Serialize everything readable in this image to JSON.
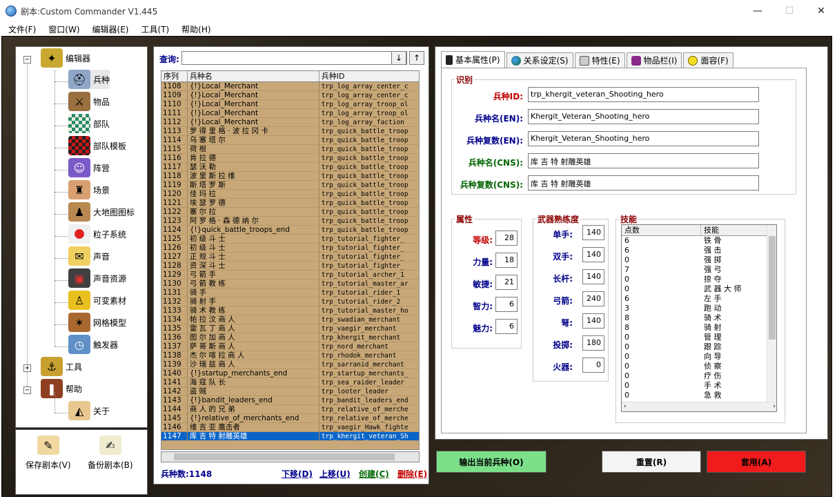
{
  "window": {
    "title": "剧本:Custom Commander V1.445",
    "minimize": "—",
    "maximize": "☐",
    "close": "✕"
  },
  "menu": [
    "文件(F)",
    "窗口(W)",
    "编辑器(E)",
    "工具(T)",
    "帮助(H)"
  ],
  "tree": {
    "editor": "编辑器",
    "items": [
      "兵种",
      "物品",
      "部队",
      "部队模板",
      "阵营",
      "场景",
      "大地图图标",
      "粒子系统",
      "声音",
      "声音资源",
      "可变素材",
      "网格模型",
      "触发器"
    ],
    "tools": "工具",
    "help": "帮助",
    "about": "关于",
    "minus": "−",
    "plus": "+"
  },
  "bottom_left": {
    "save": "保存剧本(V)",
    "backup": "备份剧本(B)"
  },
  "query": {
    "label": "查询:",
    "down": "↓",
    "up": "↑"
  },
  "grid": {
    "headers": [
      "序列",
      "兵种名",
      "兵种ID"
    ],
    "rows": [
      [
        "1108",
        "{!}Local_Merchant",
        "trp_log_array_center_c"
      ],
      [
        "1109",
        "{!}Local_Merchant",
        "trp_log_array_center_c"
      ],
      [
        "1110",
        "{!}Local_Merchant",
        "trp_log_array_troop_ol"
      ],
      [
        "1111",
        "{!}Local_Merchant",
        "trp_log_array_troop_ol"
      ],
      [
        "1112",
        "{!}Local_Merchant",
        "trp_log_array_faction"
      ],
      [
        "1113",
        "罗 得 里 格 · 波 拉 冈 卡",
        "trp_quick_battle_troop"
      ],
      [
        "1114",
        "乌 塞 塔 尔",
        "trp_quick_battle_troop"
      ],
      [
        "1115",
        "荷 根",
        "trp_quick_battle_troop"
      ],
      [
        "1116",
        "肯 拉 德",
        "trp_quick_battle_troop"
      ],
      [
        "1117",
        "瑟 沃 勒",
        "trp_quick_battle_troop"
      ],
      [
        "1118",
        "波 里 斯 拉 维",
        "trp_quick_battle_troop"
      ],
      [
        "1119",
        "斯 塔 罗 斯",
        "trp_quick_battle_troop"
      ],
      [
        "1120",
        "佳 玛 拉",
        "trp_quick_battle_troop"
      ],
      [
        "1121",
        "埃 瑟 罗 德",
        "trp_quick_battle_troop"
      ],
      [
        "1122",
        "塞 尔 拉",
        "trp_quick_battle_troop"
      ],
      [
        "1123",
        "阿 罗 格 · 森 德 纳 尔",
        "trp_quick_battle_troop"
      ],
      [
        "1124",
        "{!}quick_battle_troops_end",
        "trp_quick_battle_troop"
      ],
      [
        "1125",
        "初 级 斗 士",
        "trp_tutorial_fighter_"
      ],
      [
        "1126",
        "初 级 斗 士",
        "trp_tutorial_fighter_"
      ],
      [
        "1127",
        "正 规 斗 士",
        "trp_tutorial_fighter_"
      ],
      [
        "1128",
        "资 深 斗 士",
        "trp_tutorial_fighter_"
      ],
      [
        "1129",
        "弓 箭 手",
        "trp_tutorial_archer_1"
      ],
      [
        "1130",
        "弓 箭 教 练",
        "trp_tutorial_master_ar"
      ],
      [
        "1131",
        "骑 手",
        "trp_tutorial_rider_1"
      ],
      [
        "1132",
        "骑 射 手",
        "trp_tutorial_rider_2"
      ],
      [
        "1133",
        "骑 术 教 练",
        "trp_tutorial_master_ho"
      ],
      [
        "1134",
        "帕 拉 汶 商 人",
        "trp_swadian_merchant"
      ],
      [
        "1135",
        "雷 瓦 丁 商 人",
        "trp_vaegir_merchant"
      ],
      [
        "1136",
        "图 尔 加 商 人",
        "trp_khergit_merchant"
      ],
      [
        "1137",
        "萨 哥 斯 商 人",
        "trp_nord_merchant"
      ],
      [
        "1138",
        "杰 尔 喀 拉 商 人",
        "trp_rhodok_merchant"
      ],
      [
        "1139",
        "沙 瑞 兹 商 人",
        "trp_sarranid_merchant"
      ],
      [
        "1140",
        "{!}startup_merchants_end",
        "trp_startup_merchants_"
      ],
      [
        "1141",
        "海 寇 队 长",
        "trp_sea_raider_leader"
      ],
      [
        "1142",
        "盗 贼",
        "trp_looter_leader"
      ],
      [
        "1143",
        "{!}bandit_leaders_end",
        "trp_bandit_leaders_end"
      ],
      [
        "1144",
        "商 人 的 兄 弟",
        "trp_relative_of_merche"
      ],
      [
        "1145",
        "{!}relative_of_merchants_end",
        "trp_relative_of_merche"
      ],
      [
        "1146",
        "维 吉 亚 鹰击者",
        "trp_vaegir_Hawk_fighte"
      ],
      [
        "1147",
        "库 吉 特 射雕英雄",
        "trp_khergit_veteran_Sh"
      ]
    ],
    "selected_index": 39
  },
  "footer": {
    "count_label": "兵种数:1148",
    "down": "下移(D)",
    "up": "上移(U)",
    "create": "创建(C)",
    "delete": "删除(E)"
  },
  "tabs": [
    "基本属性(P)",
    "关系设定(S)",
    "特性(E)",
    "物品栏(I)",
    "面容(F)"
  ],
  "identity": {
    "legend": "识别",
    "labels": [
      "兵种ID:",
      "兵种名(EN):",
      "兵种复数(EN):",
      "兵种名(CNS):",
      "兵种复数(CNS):"
    ],
    "values": [
      "trp_khergit_veteran_Shooting_hero",
      "Khergit_Veteran_Shooting_hero",
      "Khergit_Veteran_Shooting_hero",
      "库 吉 特 射雕英雄",
      "库 吉 特 射雕英雄"
    ]
  },
  "attributes": {
    "legend": "属性",
    "labels": [
      "等级:",
      "力量:",
      "敏捷:",
      "智力:",
      "魅力:"
    ],
    "values": [
      "28",
      "18",
      "21",
      "6",
      "6"
    ]
  },
  "weapons": {
    "legend": "武器熟练度",
    "labels": [
      "单手:",
      "双手:",
      "长杆:",
      "弓箭:",
      "弩:",
      "投掷:",
      "火器:"
    ],
    "values": [
      "140",
      "140",
      "140",
      "240",
      "140",
      "180",
      "0"
    ]
  },
  "skills": {
    "legend": "技能",
    "headers": [
      "点数",
      "技能"
    ],
    "rows": [
      [
        "6",
        "铁 骨"
      ],
      [
        "6",
        "强 击"
      ],
      [
        "0",
        "强 掷"
      ],
      [
        "7",
        "强 弓"
      ],
      [
        "0",
        "掠 夺"
      ],
      [
        "0",
        "武 器 大 师"
      ],
      [
        "6",
        "左 手"
      ],
      [
        "3",
        "跑 动"
      ],
      [
        "8",
        "骑 术"
      ],
      [
        "8",
        "骑 射"
      ],
      [
        "0",
        "管 理"
      ],
      [
        "0",
        "跟 踪"
      ],
      [
        "0",
        "向 导"
      ],
      [
        "0",
        "侦 察"
      ],
      [
        "0",
        "疗 伤"
      ],
      [
        "0",
        "手 术"
      ],
      [
        "0",
        "急 救"
      ]
    ],
    "scroll_left": "‹",
    "scroll_right": "›"
  },
  "buttons": {
    "export": "输出当前兵种(O)",
    "reset": "重置(R)",
    "apply": "套用(A)"
  }
}
